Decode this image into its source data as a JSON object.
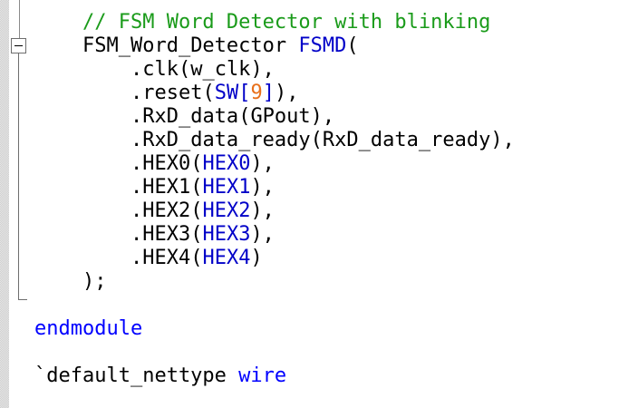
{
  "editor": {
    "lines": [
      {
        "indent": "    ",
        "comment": "// FSM Word Detector with blinking"
      },
      {
        "indent": "    ",
        "module": "FSM_Word_Detector",
        "space": " ",
        "instance": "FSMD",
        "open": "("
      },
      {
        "indent": "        ",
        "port": ".clk",
        "po": "(",
        "arg": "w_clk",
        "pc": "),",
        "kind": "plain"
      },
      {
        "indent": "        ",
        "port": ".reset",
        "po": "(",
        "sig": "SW",
        "bo": "[",
        "idx": "9",
        "bc": "]",
        "pc": "),",
        "kind": "index"
      },
      {
        "indent": "        ",
        "port": ".RxD_data",
        "po": "(",
        "arg": "GPout",
        "pc": "),",
        "kind": "plain"
      },
      {
        "indent": "        ",
        "port": ".RxD_data_ready",
        "po": "(",
        "arg": "RxD_data_ready",
        "pc": "),",
        "kind": "plain"
      },
      {
        "indent": "        ",
        "port": ".HEX0",
        "po": "(",
        "arg": "HEX0",
        "pc": "),",
        "kind": "blue"
      },
      {
        "indent": "        ",
        "port": ".HEX1",
        "po": "(",
        "arg": "HEX1",
        "pc": "),",
        "kind": "blue"
      },
      {
        "indent": "        ",
        "port": ".HEX2",
        "po": "(",
        "arg": "HEX2",
        "pc": "),",
        "kind": "blue"
      },
      {
        "indent": "        ",
        "port": ".HEX3",
        "po": "(",
        "arg": "HEX3",
        "pc": "),",
        "kind": "blue"
      },
      {
        "indent": "        ",
        "port": ".HEX4",
        "po": "(",
        "arg": "HEX4",
        "pc": ")",
        "kind": "blue"
      },
      {
        "indent": "    ",
        "close": ");"
      },
      {
        "blank": ""
      },
      {
        "keyword": "endmodule"
      },
      {
        "blank": ""
      },
      {
        "directive": "`default_nettype",
        "space": " ",
        "keyword": "wire"
      }
    ]
  },
  "colors": {
    "comment": "#1a9b1a",
    "keyword": "#0000ff",
    "identifier": "#0000c8",
    "number": "#e8701a",
    "text": "#000000"
  },
  "icons": {
    "fold_toggle": "collapse-minus-icon"
  }
}
